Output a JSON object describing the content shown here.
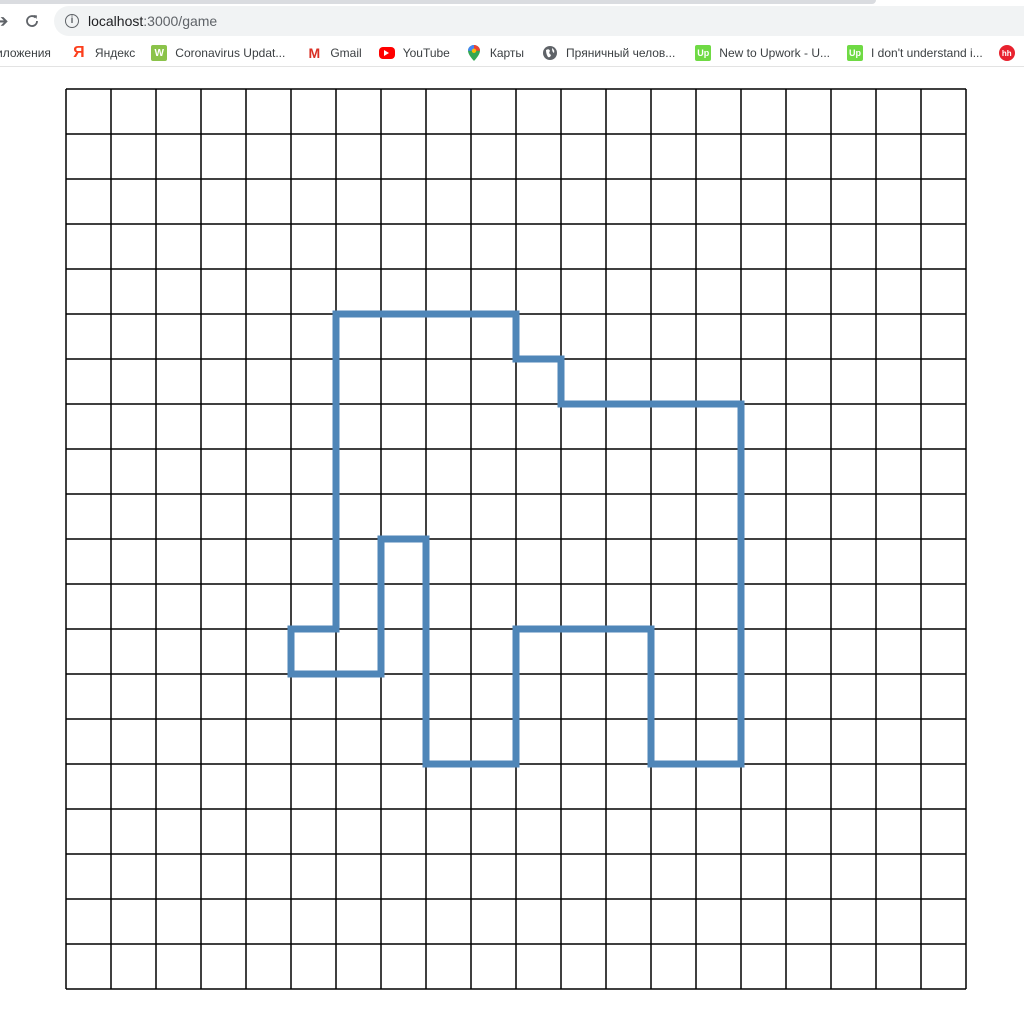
{
  "browser": {
    "url_host": "localhost",
    "url_path": ":3000/game",
    "bookmarks": [
      {
        "label": "иложения",
        "icon": "apps-icon"
      },
      {
        "label": "Яндекс",
        "icon": "yandex-icon",
        "glyph": "Я"
      },
      {
        "label": "Coronavirus Updat...",
        "icon": "coronavirus-icon",
        "glyph": "W"
      },
      {
        "label": "Gmail",
        "icon": "gmail-icon",
        "glyph": "M"
      },
      {
        "label": "YouTube",
        "icon": "youtube-icon"
      },
      {
        "label": "Карты",
        "icon": "maps-pin-icon"
      },
      {
        "label": "Пряничный челов...",
        "icon": "globe-icon"
      },
      {
        "label": "New to Upwork - U...",
        "icon": "upwork-icon",
        "glyph": "Up"
      },
      {
        "label": "I don't understand i...",
        "icon": "upwork-icon",
        "glyph": "Up"
      },
      {
        "label": "",
        "icon": "hh-icon",
        "glyph": "hh"
      }
    ]
  },
  "game": {
    "grid": {
      "rows": 20,
      "cols": 20,
      "line_color": "#000000"
    },
    "path_color": "#4f86b8",
    "path_cells": [
      [
        6,
        5
      ],
      [
        10,
        5
      ],
      [
        10,
        6
      ],
      [
        11,
        6
      ],
      [
        11,
        7
      ],
      [
        15,
        7
      ],
      [
        15,
        15
      ],
      [
        13,
        15
      ],
      [
        13,
        12
      ],
      [
        10,
        12
      ],
      [
        10,
        15
      ],
      [
        8,
        15
      ],
      [
        8,
        10
      ],
      [
        7,
        10
      ],
      [
        7,
        13
      ],
      [
        5,
        13
      ],
      [
        5,
        12
      ],
      [
        6,
        12
      ],
      [
        6,
        5
      ]
    ]
  }
}
